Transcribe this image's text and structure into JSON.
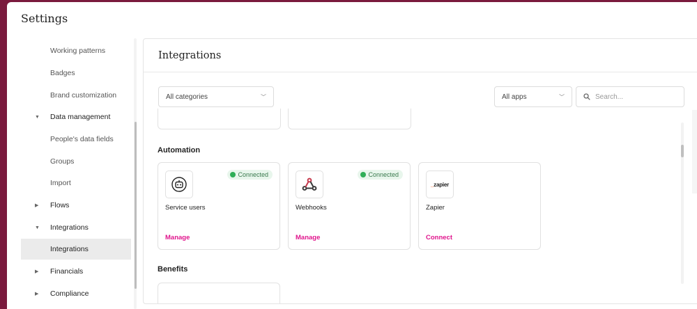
{
  "window": {
    "title": "Settings"
  },
  "sidebar": {
    "items": [
      {
        "label": "Working patterns",
        "kind": "sub"
      },
      {
        "label": "Badges",
        "kind": "sub"
      },
      {
        "label": "Brand customization",
        "kind": "sub"
      },
      {
        "label": "Data management",
        "kind": "group",
        "expanded": true
      },
      {
        "label": "People's data fields",
        "kind": "sub"
      },
      {
        "label": "Groups",
        "kind": "sub"
      },
      {
        "label": "Import",
        "kind": "sub"
      },
      {
        "label": "Flows",
        "kind": "group",
        "expanded": false
      },
      {
        "label": "Integrations",
        "kind": "group",
        "expanded": true
      },
      {
        "label": "Integrations",
        "kind": "sub",
        "active": true
      },
      {
        "label": "Financials",
        "kind": "group",
        "expanded": false
      },
      {
        "label": "Compliance",
        "kind": "group",
        "expanded": false
      }
    ]
  },
  "panel": {
    "title": "Integrations",
    "filters": {
      "category": "All categories",
      "apps": "All apps",
      "search_placeholder": "Search..."
    },
    "sections": [
      {
        "title": "Automation",
        "cards": [
          {
            "name": "Service users",
            "status": "Connected",
            "action": "Manage",
            "icon": "robot-icon"
          },
          {
            "name": "Webhooks",
            "status": "Connected",
            "action": "Manage",
            "icon": "webhooks-icon"
          },
          {
            "name": "Zapier",
            "status": "",
            "action": "Connect",
            "icon": "zapier-logo",
            "logo_text_prefix": "_",
            "logo_text": "zapier"
          }
        ]
      },
      {
        "title": "Benefits",
        "cards": []
      }
    ]
  },
  "colors": {
    "background": "#7a1a3d",
    "accent": "#e0158d",
    "connected": "#2fae57"
  }
}
